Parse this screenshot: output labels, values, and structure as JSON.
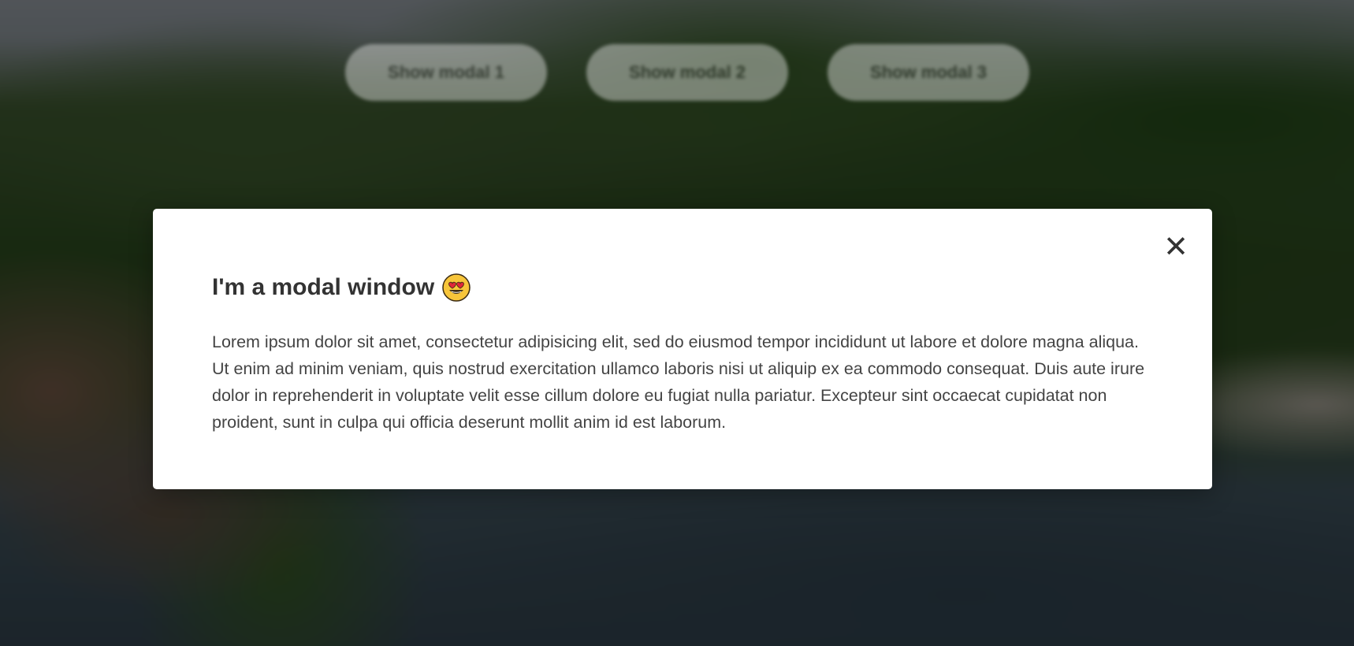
{
  "buttons": [
    {
      "label": "Show modal 1"
    },
    {
      "label": "Show modal 2"
    },
    {
      "label": "Show modal 3"
    }
  ],
  "modal": {
    "title": "I'm a modal window",
    "title_emoji": "smiling-face-with-heart-eyes-icon",
    "close_glyph": "✕",
    "body": "Lorem ipsum dolor sit amet, consectetur adipisicing elit, sed do eiusmod tempor incididunt ut labore et dolore magna aliqua. Ut enim ad minim veniam, quis nostrud exercitation ullamco laboris nisi ut aliquip ex ea commodo consequat. Duis aute irure dolor in reprehenderit in voluptate velit esse cillum dolore eu fugiat nulla pariatur. Excepteur sint occaecat cupidatat non proident, sunt in culpa qui officia deserunt mollit anim id est laborum."
  },
  "colors": {
    "overlay": "#000000",
    "modal_bg": "#ffffff",
    "text": "#333333"
  }
}
